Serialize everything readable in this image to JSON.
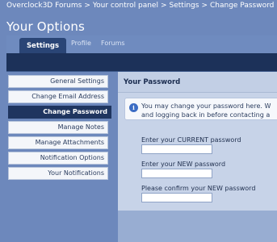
{
  "breadcrumb": {
    "items": [
      "Overclock3D Forums",
      "Your control panel",
      "Settings",
      "Change Password"
    ],
    "separator": ">"
  },
  "page": {
    "title": "Your Options"
  },
  "tabs": [
    {
      "label": "Settings",
      "active": true
    },
    {
      "label": "Profile",
      "active": false
    },
    {
      "label": "Forums",
      "active": false
    }
  ],
  "sidebar": {
    "items": [
      {
        "label": "General Settings",
        "active": false
      },
      {
        "label": "Change Email Address",
        "active": false
      },
      {
        "label": "Change Password",
        "active": true
      },
      {
        "label": "Manage Notes",
        "active": false
      },
      {
        "label": "Manage Attachments",
        "active": false
      },
      {
        "label": "Notification Options",
        "active": false
      },
      {
        "label": "Your Notifications",
        "active": false
      }
    ]
  },
  "main": {
    "section_title": "Your Password",
    "info": {
      "icon": "info-icon",
      "line1": "You may change your password here. W",
      "line2": "and logging back in before contacting a"
    },
    "fields": [
      {
        "label": "Enter your CURRENT password",
        "value": ""
      },
      {
        "label": "Enter your NEW password",
        "value": ""
      },
      {
        "label": "Please confirm your NEW password",
        "value": ""
      }
    ]
  },
  "colors": {
    "background": "#6d88bc",
    "navy": "#1c3159",
    "active_tab": "#2a4576",
    "panel": "#c7d3e8"
  }
}
